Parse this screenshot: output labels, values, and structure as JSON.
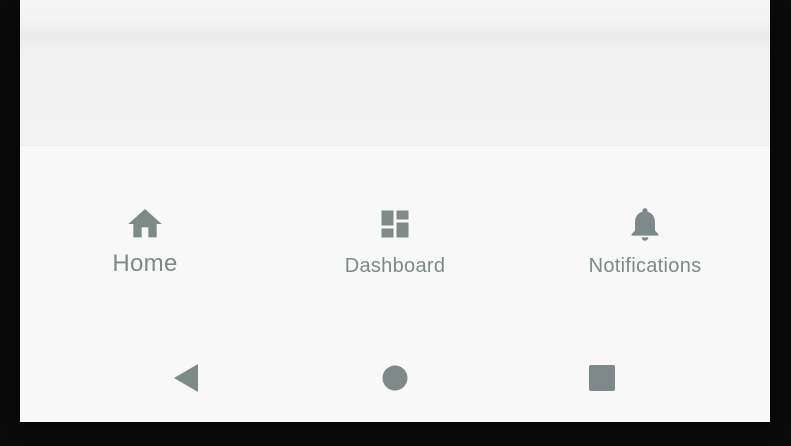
{
  "colors": {
    "icon": "#7d8a88",
    "label": "#7d8a88",
    "surface": "#f8f8f8"
  },
  "bottom_nav": {
    "items": [
      {
        "label": "Home",
        "icon": "home-icon",
        "active": true
      },
      {
        "label": "Dashboard",
        "icon": "dashboard-icon",
        "active": false
      },
      {
        "label": "Notifications",
        "icon": "bell-icon",
        "active": false
      }
    ]
  },
  "system_nav": {
    "buttons": [
      {
        "icon": "back-triangle-icon"
      },
      {
        "icon": "home-circle-icon"
      },
      {
        "icon": "recents-square-icon"
      }
    ]
  }
}
